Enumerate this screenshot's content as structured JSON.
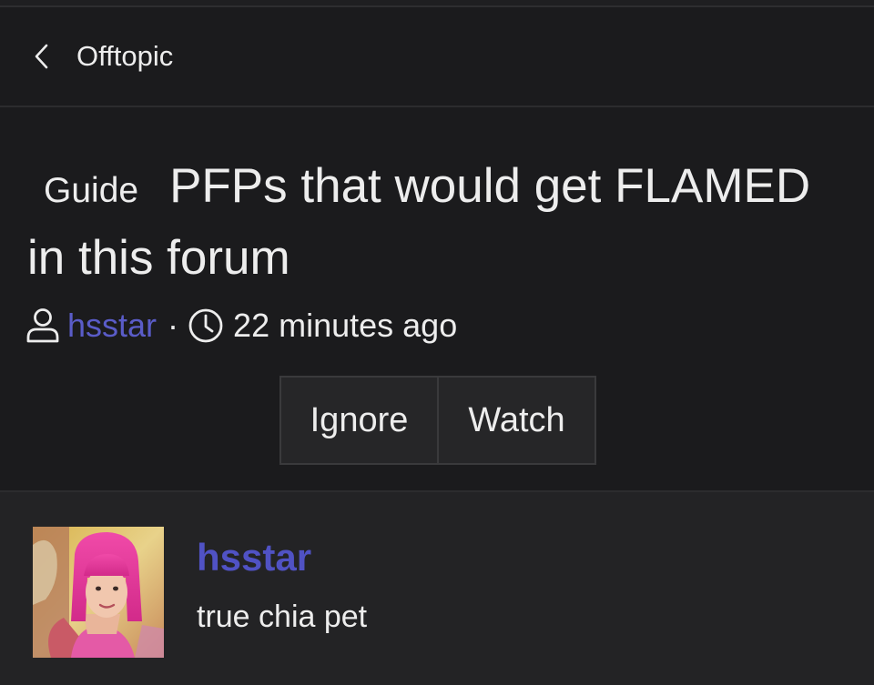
{
  "nav": {
    "back_label": "Offtopic"
  },
  "thread": {
    "prefix": "Guide",
    "title": "PFPs that would get FLAMED in this forum",
    "author": "hsstar",
    "separator": "·",
    "time": "22 minutes ago"
  },
  "actions": {
    "ignore_label": "Ignore",
    "watch_label": "Watch"
  },
  "post": {
    "author": "hsstar",
    "body": "true chia pet"
  },
  "icons": {
    "back": "chevron-left-icon",
    "user": "user-icon",
    "clock": "clock-icon"
  },
  "colors": {
    "background": "#1b1b1d",
    "post_background": "#232325",
    "link": "#5a5cc8",
    "text": "#ededed",
    "button_background": "#262628"
  }
}
